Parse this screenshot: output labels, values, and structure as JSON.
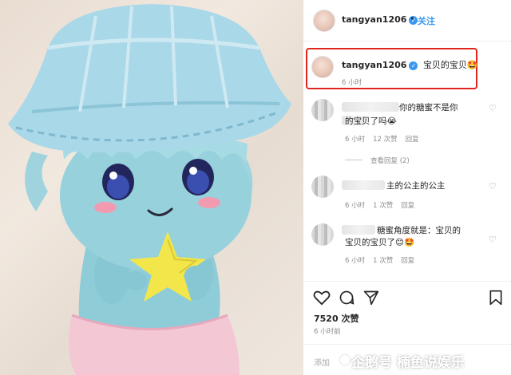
{
  "post": {
    "username": "tangyan1206",
    "follow_label": "关注",
    "dot": "•"
  },
  "caption": {
    "username": "tangyan1206",
    "text": "宝贝的宝贝🤩",
    "time": "6 小时"
  },
  "comments": [
    {
      "line1": "你的糖蜜不是你",
      "line2": "的宝贝了吗😭",
      "time": "6 小时",
      "likes": "12 次赞",
      "reply": "回复",
      "view_replies": "查看回复 (2)"
    },
    {
      "line1": "主的公主的公主",
      "time": "6 小时",
      "likes": "1 次赞",
      "reply": "回复"
    },
    {
      "line1": "糖蜜角度就是：宝贝的",
      "line2": "宝贝的宝贝了😊🤩",
      "time": "6 小时",
      "likes": "1 次赞",
      "reply": "回复"
    }
  ],
  "actions": {
    "likes": "7520 次赞",
    "time": "6 小时前",
    "add_comment_placeholder": "添加",
    "icons": [
      "heart-icon",
      "comment-icon",
      "share-icon",
      "bookmark-icon"
    ]
  },
  "watermark": {
    "text": "企鹅号 楠鱼说娱乐"
  },
  "colors": {
    "accent": "#3897f0",
    "highlight_border": "#e0251f",
    "muted": "#8e8e8e"
  }
}
